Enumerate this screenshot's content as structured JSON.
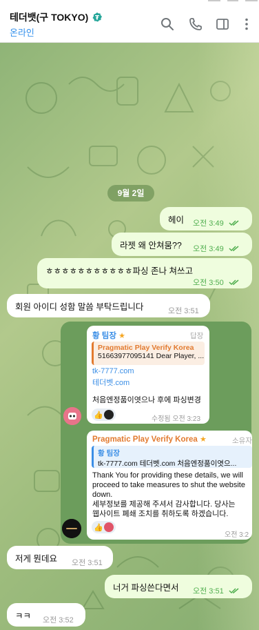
{
  "header": {
    "title": "테더뱃(구 TOKYO)",
    "status": "온라인",
    "icons": [
      "search-icon",
      "phone-icon",
      "sidebar-icon",
      "more-icon"
    ],
    "verified_color": "#26a69a"
  },
  "date_divider": "9월 2일",
  "messages": [
    {
      "text": "헤이",
      "time": "오전 3:49"
    },
    {
      "text": "라젯 왜 안쳐뭄??",
      "time": "오전 3:49"
    },
    {
      "text": "ㅎㅎㅎㅎㅎㅎㅎㅎㅎㅎㅎ파싱 존나 쳐쓰고",
      "time": "오전 3:50"
    },
    {
      "text": "회원 아이디 성함 말씀 부탁드립니다",
      "time": "오전 3:51"
    },
    {
      "text": "저게 뭔데요",
      "time": "오전 3:51"
    },
    {
      "text": "너거 파싱쓴다면서",
      "time": "오전 3:51"
    },
    {
      "text": "ㅋㅋ",
      "time": "오전 3:52"
    }
  ],
  "forward1": {
    "sender": "황 팀장",
    "star": "★",
    "tag": "답장",
    "quote_title": "Pragmatic Play Verify Korea",
    "quote_text": "51663977095141 Dear Player, ...",
    "link1": "tk-7777.com",
    "link2": "테더벳.com",
    "body": "처음엔정품이엿으나 후에 파싱변경",
    "edited": "수정됨 오전 3:23",
    "reaction": "👍"
  },
  "forward2": {
    "sender": "Pragmatic Play Verify Korea",
    "star": "★",
    "tag": "소유자",
    "quote_title": "황 팀장",
    "quote_text": "tk-7777.com 테더벳.com  처음엔정품이엿으...",
    "body_line1": "Thank You for providing these details, we will",
    "body_line2": "proceed to take measures to shut the website",
    "body_line3": "down.",
    "body_line4": "세부정보를 제공해 주셔서 감사합니다. 당사는",
    "body_line5": "웹사이트 폐쇄 조치를 취하도록 하겠습니다.",
    "time": "오전 3:2",
    "reaction": "👍"
  }
}
